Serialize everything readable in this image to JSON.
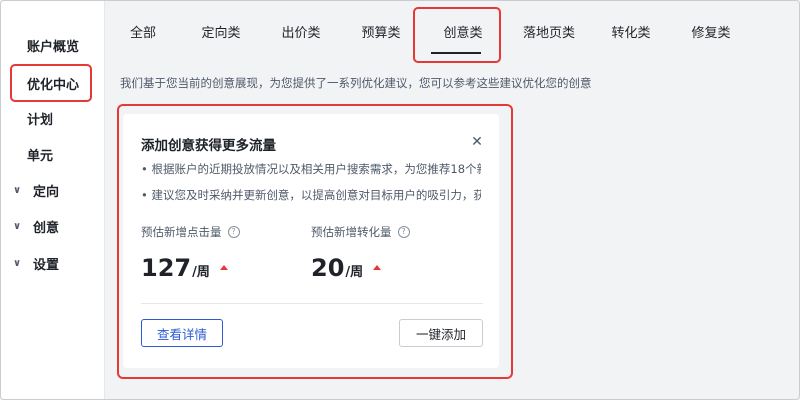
{
  "sidebar": {
    "items": [
      {
        "label": "账户概览",
        "expandable": false,
        "active": false
      },
      {
        "label": "优化中心",
        "expandable": false,
        "active": true
      },
      {
        "label": "计划",
        "expandable": false,
        "active": false
      },
      {
        "label": "单元",
        "expandable": false,
        "active": false
      },
      {
        "label": "定向",
        "expandable": true,
        "active": false
      },
      {
        "label": "创意",
        "expandable": true,
        "active": false
      },
      {
        "label": "设置",
        "expandable": true,
        "active": false
      }
    ],
    "chevron": "chevron-down-icon"
  },
  "tabs": [
    {
      "label": "全部"
    },
    {
      "label": "定向类"
    },
    {
      "label": "出价类"
    },
    {
      "label": "预算类"
    },
    {
      "label": "创意类",
      "active": true
    },
    {
      "label": "落地页类"
    },
    {
      "label": "转化类"
    },
    {
      "label": "修复类"
    }
  ],
  "description": "我们基于您当前的创意展现，为您提供了一系列优化建议，您可以参考这些建议优化您的创意",
  "card": {
    "title": "添加创意获得更多流量",
    "bullets": [
      "• 根据账户的近期投放情况以及相关用户搜索需求，为您推荐18个新...",
      "• 建议您及时采纳并更新创意，以提高创意对目标用户的吸引力，获..."
    ],
    "metrics": [
      {
        "label": "预估新增点击量",
        "value": "127",
        "unit": "/周",
        "trend": "up"
      },
      {
        "label": "预估新增转化量",
        "value": "20",
        "unit": "/周",
        "trend": "up"
      }
    ],
    "details_button": "查看详情",
    "add_button": "一键添加"
  },
  "colors": {
    "highlight": "#e53935",
    "primary": "#2d5bd3",
    "trend_up": "#e53935"
  }
}
